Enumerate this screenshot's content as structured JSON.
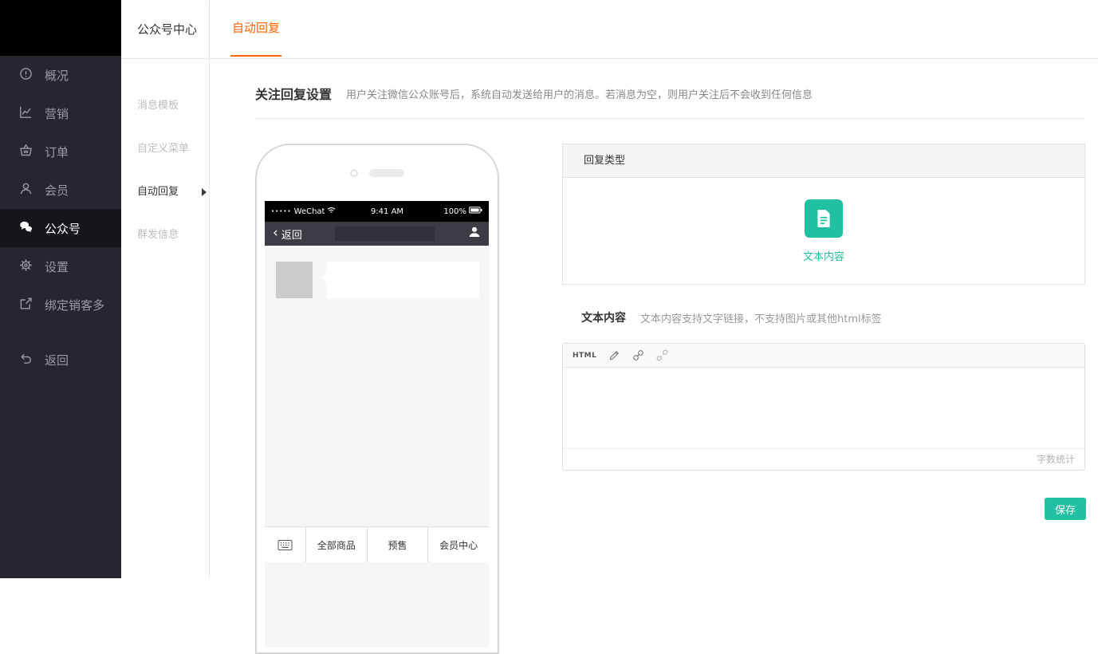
{
  "colors": {
    "accent_orange": "#ff6600",
    "accent_teal": "#20c0a2",
    "sidebar_bg": "#26262e"
  },
  "sidebar": {
    "items": [
      {
        "label": "概况",
        "icon": "overview-icon"
      },
      {
        "label": "营销",
        "icon": "marketing-icon"
      },
      {
        "label": "订单",
        "icon": "orders-icon"
      },
      {
        "label": "会员",
        "icon": "members-icon"
      },
      {
        "label": "公众号",
        "icon": "wechat-icon",
        "active": true
      },
      {
        "label": "设置",
        "icon": "settings-icon"
      },
      {
        "label": "绑定销客多",
        "icon": "bind-icon"
      },
      {
        "label": "返回",
        "icon": "back-icon"
      }
    ]
  },
  "subsidebar": {
    "title": "公众号中心",
    "items": [
      {
        "label": "消息模板"
      },
      {
        "label": "自定义菜单"
      },
      {
        "label": "自动回复",
        "active": true
      },
      {
        "label": "群发信息"
      }
    ]
  },
  "topbar": {
    "active_tab": "自动回复"
  },
  "main": {
    "title": "关注回复设置",
    "description": "用户关注微信公众账号后，系统自动发送给用户的消息。若消息为空，则用户关注后不会收到任何信息",
    "reply_type_header": "回复类型",
    "reply_type_option": "文本内容",
    "text_label": "文本内容",
    "text_desc": "文本内容支持文字链接，不支持图片或其他html标签",
    "editor": {
      "html_button": "HTML",
      "word_count": "字数统计"
    },
    "save": "保存"
  },
  "phone": {
    "carrier_dots": "•••••",
    "carrier": "WeChat",
    "time": "9:41 AM",
    "battery": "100%",
    "back_chevron": "‹",
    "back": "返回",
    "tabs": [
      "全部商品",
      "预售",
      "会员中心"
    ]
  }
}
